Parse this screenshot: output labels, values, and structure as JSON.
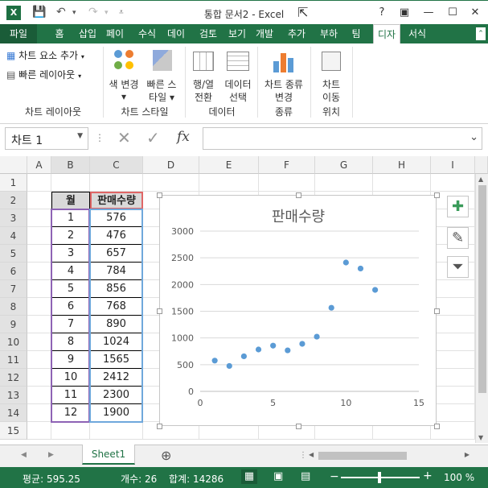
{
  "window": {
    "title": "통합 문서2 - Excel",
    "help": "?",
    "ribbon_display": "▣",
    "minimize": "—",
    "maximize": "☐",
    "close": "✕"
  },
  "tabs": [
    "파일",
    "홈",
    "삽입",
    "페이",
    "수식",
    "데이",
    "검토",
    "보기",
    "개발",
    "추가",
    "부하",
    "팀",
    "디자",
    "서식"
  ],
  "ribbon": {
    "add_element": "차트 요소 추가",
    "quick_layout": "빠른 레이아웃",
    "group_layout": "차트 레이아웃",
    "color_change": "색 변경",
    "quick_style_1": "빠른 스",
    "quick_style_2": "타일",
    "group_style": "차트 스타일",
    "switch_1": "행/열",
    "switch_2": "전환",
    "select_data_1": "데이터",
    "select_data_2": "선택",
    "group_data": "데이터",
    "change_type_1": "차트 종류",
    "change_type_2": "변경",
    "group_type": "종류",
    "move_chart_1": "차트",
    "move_chart_2": "이동",
    "group_location": "위치"
  },
  "formula": {
    "name_box": "차트 1",
    "fx": "fx",
    "value": ""
  },
  "columns": [
    "A",
    "B",
    "C",
    "D",
    "E",
    "F",
    "G",
    "H",
    "I"
  ],
  "rows": [
    "1",
    "2",
    "3",
    "4",
    "5",
    "6",
    "7",
    "8",
    "9",
    "10",
    "11",
    "12",
    "13",
    "14",
    "15"
  ],
  "table": {
    "header_month": "월",
    "header_sales": "판매수량",
    "months": [
      "1",
      "2",
      "3",
      "4",
      "5",
      "6",
      "7",
      "8",
      "9",
      "10",
      "11",
      "12"
    ],
    "sales": [
      "576",
      "476",
      "657",
      "784",
      "856",
      "768",
      "890",
      "1024",
      "1565",
      "2412",
      "2300",
      "1900"
    ]
  },
  "chart_data": {
    "type": "scatter",
    "title": "판매수량",
    "x": [
      1,
      2,
      3,
      4,
      5,
      6,
      7,
      8,
      9,
      10,
      11,
      12
    ],
    "y": [
      576,
      476,
      657,
      784,
      856,
      768,
      890,
      1024,
      1565,
      2412,
      2300,
      1900
    ],
    "xlim": [
      0,
      15
    ],
    "ylim": [
      0,
      3000
    ],
    "x_ticks": [
      "0",
      "5",
      "10",
      "15"
    ],
    "y_ticks": [
      "0",
      "500",
      "1000",
      "1500",
      "2000",
      "2500",
      "3000"
    ],
    "grid": "horizontal",
    "marker_color": "#5b9bd5"
  },
  "sheet": {
    "name": "Sheet1",
    "add": "⊕"
  },
  "status": {
    "average": "평균: 595.25",
    "count": "개수: 26",
    "sum": "합계: 14286",
    "zoom": "100 %"
  }
}
